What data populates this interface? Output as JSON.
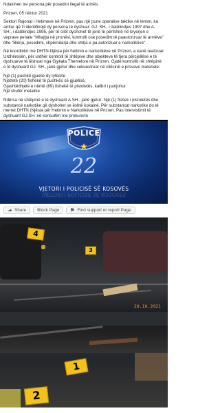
{
  "post": {
    "paragraphs": [
      "Ndalohen tre persona për posedim ilegal të armës",
      "Prizren, 05 nëntor 2021",
      "Sektori Rajonal i Hetimeve në Prizren, pas një pune operative taktike në terren, ka arritur që t'i identifikojë dy persona të dyshuar: GJ. SH., i datëlindjes 1997 dhe A. SH., i datëlindjes 1995, për të cilët dyshohet të jenë të përfshirë në kryerjen e veprave penale \"Mbajtja në pronësi, kontrolli ose posedim të paautorizuar të armëve\" dhe \"Blerja, posedimi, shpërndarja dhe shitja e pa autorizuar e narkotikëve\".",
      "Në koordinim me DHTN-Njësia për hetimin e narkotikëve në Prizren, e kanë realizuar Urdhëresën, për urdhër kontrolli të shtëpive dhe objekteve të tjera përcjellëse e të dyshuarve të lëshuar nga Gjykata Themelore në Prizren. Gjatë kontrollit në shtëpinë e të dyshuarit GJ. SH., janë gjetur dhe sekuestruar në cilësinë e provave materiale:"
    ],
    "items": [
      "Një (1) pushkë gjuetie dy tytëshe",
      "Njëzetë (20) fishekë të pushkës së gjuetisë,",
      "Gjashtëdhjetë e nëntë (69) fishekë të pistoletës, kalibri i panjohur",
      "Një shufër metalike"
    ],
    "closing": "Ndërsa në shtëpinë e të dyshuarit A.SH., janë gjetur: Një (1) fishek i pistoletës dhe substancë narkotike që dyshohet se është kokainë. Për substancat narkotike do të merret DHTN (Njësia për Hetimin e Narkotikëve në Prizren. Pas intervistimit të dyshuarit GJ.SH. në konsultim me prokurorin"
  },
  "hero": {
    "badge_text": "POLICE",
    "number": "22",
    "tagline": "VJETORI I POLICISË SË KOSOVËS"
  },
  "actions": {
    "share": "Share",
    "block": "Block Page",
    "support": "Find support or report Page"
  },
  "photo1": {
    "marker_4": "4",
    "marker_3": "3",
    "timestamp": "28.10.2021"
  },
  "photo2": {
    "marker_1": "1",
    "marker_2": "2"
  },
  "colors": {
    "marker_yellow": "#f3c21b",
    "police_blue": "#1a4aa0",
    "timestamp_orange": "#ff8a2a"
  }
}
